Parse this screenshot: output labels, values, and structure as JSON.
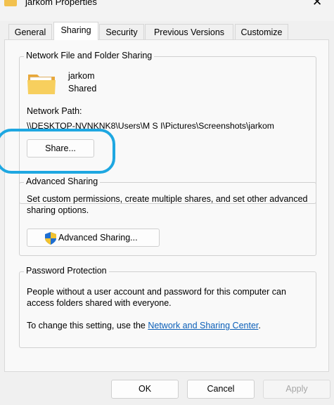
{
  "window": {
    "title": "jarkom Properties",
    "close_glyph": "✕"
  },
  "tabs": [
    {
      "label": "General",
      "active": false
    },
    {
      "label": "Sharing",
      "active": true
    },
    {
      "label": "Security",
      "active": false
    },
    {
      "label": "Previous Versions",
      "active": false
    },
    {
      "label": "Customize",
      "active": false
    }
  ],
  "network_sharing": {
    "legend": "Network File and Folder Sharing",
    "folder_name": "jarkom",
    "folder_status": "Shared",
    "network_path_label": "Network Path:",
    "network_path_value": "\\\\DESKTOP-NVNKNK8\\Users\\M S I\\Pictures\\Screenshots\\jarkom",
    "share_button": "Share..."
  },
  "advanced_sharing": {
    "legend": "Advanced Sharing",
    "description": "Set custom permissions, create multiple shares, and set other advanced sharing options.",
    "button": "Advanced Sharing..."
  },
  "password_protection": {
    "legend": "Password Protection",
    "description": "People without a user account and password for this computer can access folders shared with everyone.",
    "change_text": "To change this setting, use the",
    "link_text": "Network and Sharing Center",
    "after_link": "."
  },
  "footer": {
    "ok": "OK",
    "cancel": "Cancel",
    "apply": "Apply"
  },
  "colors": {
    "highlight": "#1ea7e1",
    "link": "#0b5fb8",
    "folder": "#f2c14e"
  }
}
